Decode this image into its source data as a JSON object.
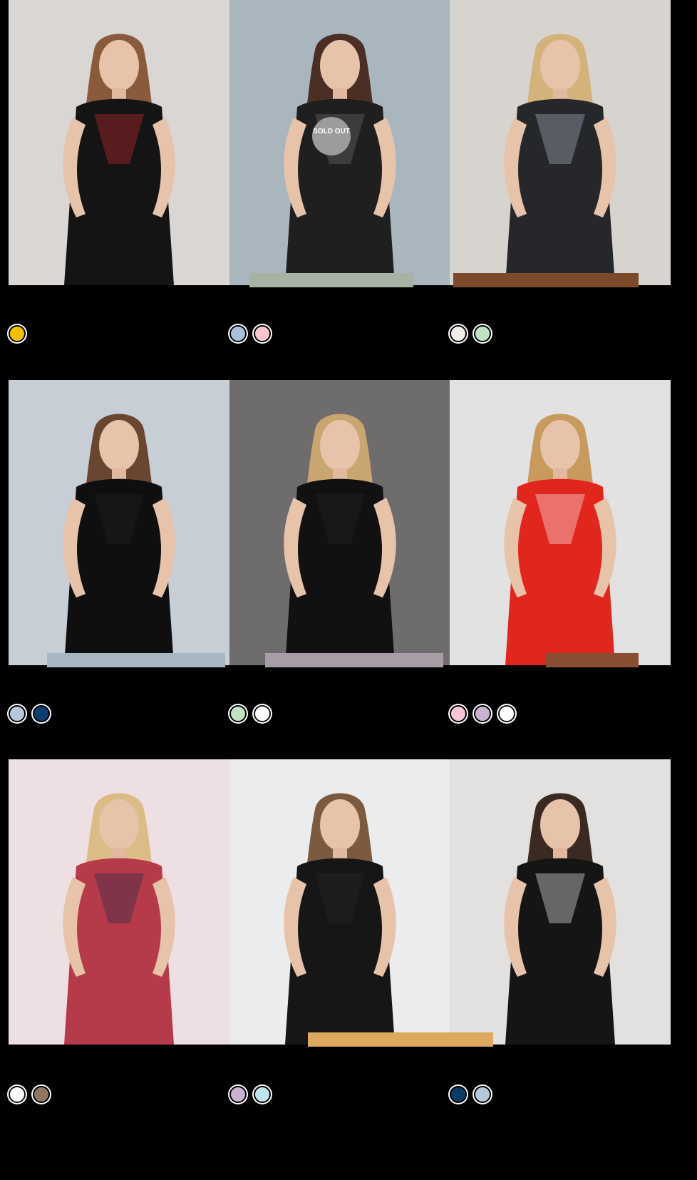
{
  "products": [
    {
      "title": "",
      "price": "",
      "swatches": [
        "#f2c200"
      ],
      "bg": "#d9d6d4",
      "fig": "#141414",
      "accent": "#d42a2f",
      "hair": "#8a5a3c",
      "badge": ""
    },
    {
      "title": "",
      "price": "",
      "swatches": [
        "#a7c0db",
        "#f8c6cf"
      ],
      "bg": "#a9b6be",
      "fig": "#1f1f1f",
      "accent": "#6f7378",
      "hair": "#4b2f24",
      "badge": "SOLD OUT"
    },
    {
      "title": "",
      "price": "",
      "swatches": [
        "#f0eee6",
        "#bfe2c0"
      ],
      "bg": "#d7d4d0",
      "fig": "#25272b",
      "accent": "#b7c0cd",
      "hair": "#d4b27b",
      "badge": ""
    },
    {
      "title": "",
      "price": "",
      "swatches": [
        "#b7c8db",
        "#0b3f6f"
      ],
      "bg": "#c7ced6",
      "fig": "#0f0f0f",
      "accent": "#262626",
      "hair": "#6a4530",
      "badge": ""
    },
    {
      "title": "",
      "price": "",
      "swatches": [
        "#bfe2c0",
        "#ffffff"
      ],
      "bg": "#6f6c6e",
      "fig": "#111111",
      "accent": "#242424",
      "hair": "#c9a570",
      "badge": ""
    },
    {
      "title": "",
      "price": "",
      "swatches": [
        "#f8c6d4",
        "#c8b3d1",
        "#ffffff"
      ],
      "bg": "#e2e2e3",
      "fig": "#e1261e",
      "accent": "#ffffff",
      "hair": "#c99a5e",
      "badge": ""
    },
    {
      "title": "",
      "price": "",
      "swatches": [
        "#ffffff",
        "#8f7761"
      ],
      "bg": "#eedfe2",
      "fig": "#b53a4a",
      "accent": "#1e2b4a",
      "hair": "#dcbc86",
      "badge": ""
    },
    {
      "title": "",
      "price": "",
      "swatches": [
        "#c8b3d1",
        "#bfe6ee"
      ],
      "bg": "#ebecee",
      "fig": "#161616",
      "accent": "#2b2b2b",
      "hair": "#7b5a3f",
      "badge": ""
    },
    {
      "title": "",
      "price": "",
      "swatches": [
        "#0c3a67",
        "#b7c8db"
      ],
      "bg": "#e2e1e0",
      "fig": "#151515",
      "accent": "#ffffff",
      "hair": "#3a2a22",
      "badge": ""
    }
  ]
}
